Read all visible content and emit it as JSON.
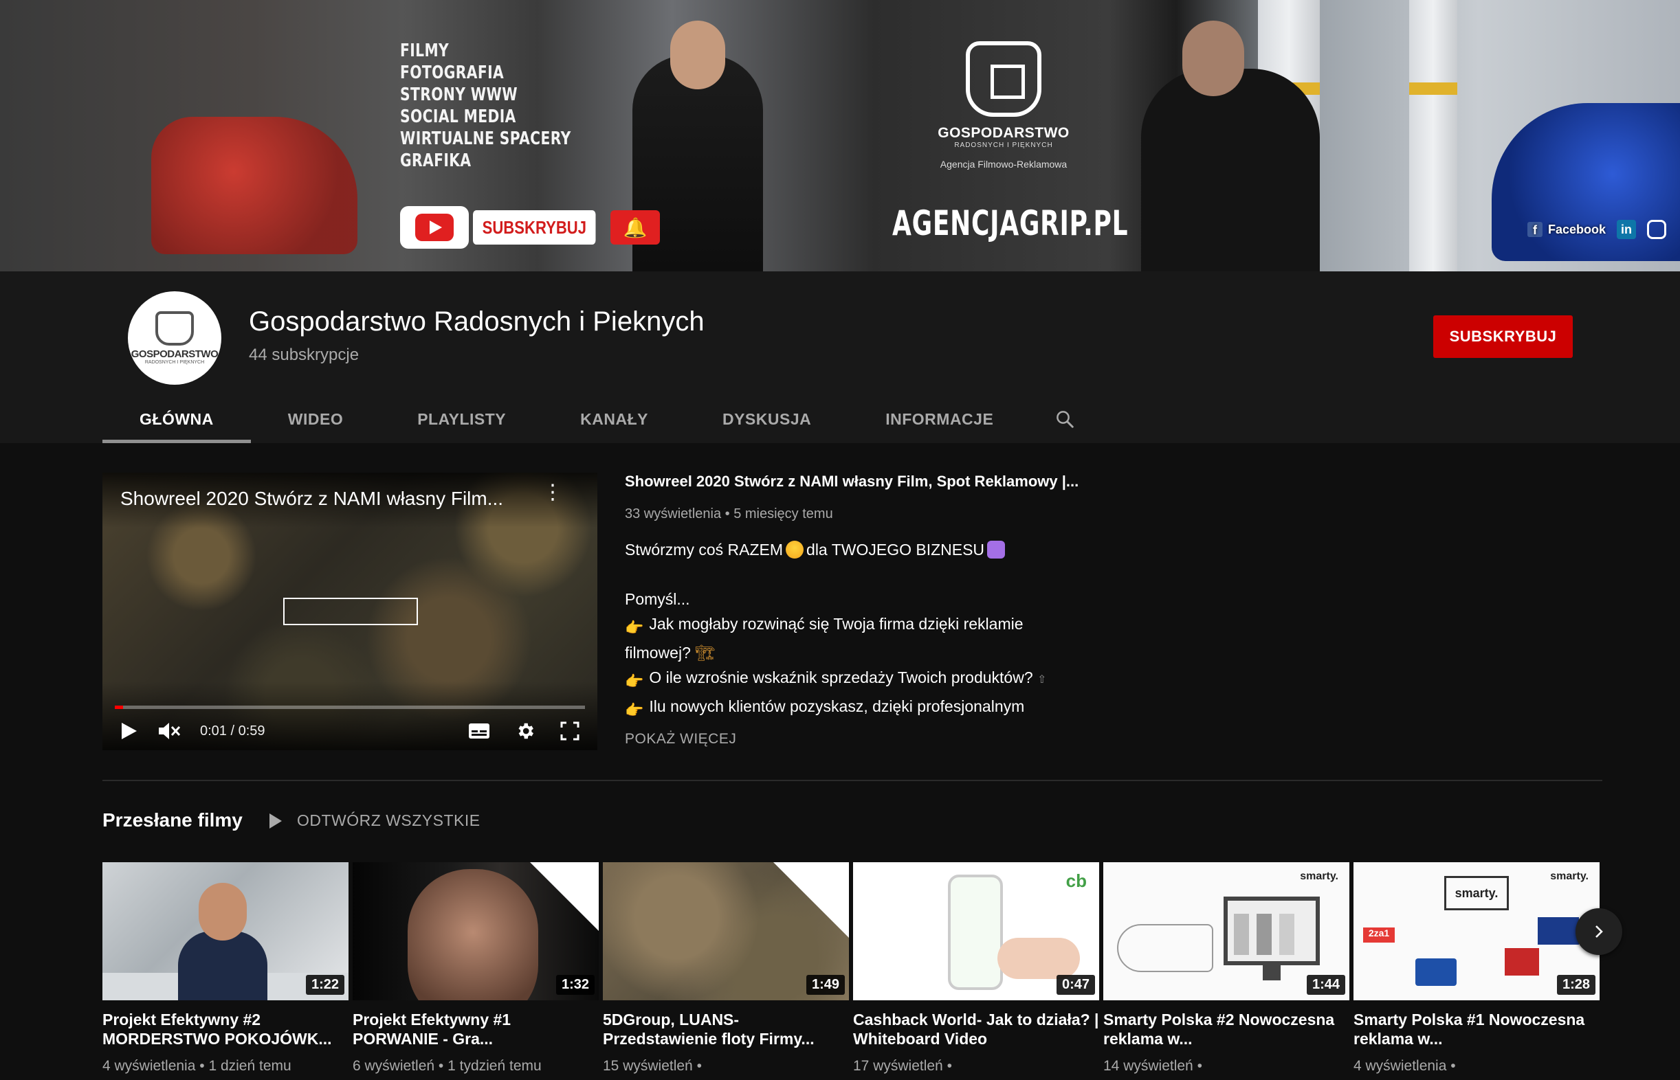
{
  "banner": {
    "services": [
      "FILMY",
      "FOTOGRAFIA",
      "STRONY WWW",
      "SOCIAL MEDIA",
      "WIRTUALNE SPACERY",
      "GRAFIKA"
    ],
    "subscribe_label": "SUBSKRYBUJ",
    "agency_name": "GOSPODARSTWO",
    "agency_sub": "RADOSNYCH I PIĘKNYCH",
    "agency_tagline": "Agencja Filmowo-Reklamowa",
    "agency_url": "AGENCJAGRIP.PL",
    "social_facebook": "Facebook",
    "social_linkedin": "in"
  },
  "channel": {
    "avatar_text": "GOSPODARSTWO",
    "avatar_sub": "RADOSNYCH I PIĘKNYCH",
    "title": "Gospodarstwo Radosnych i Pieknych",
    "subscribers": "44 subskrypcje",
    "subscribe_button": "SUBSKRYBUJ"
  },
  "tabs": [
    {
      "label": "GŁÓWNA",
      "active": true
    },
    {
      "label": "WIDEO"
    },
    {
      "label": "PLAYLISTY"
    },
    {
      "label": "KANAŁY"
    },
    {
      "label": "DYSKUSJA"
    },
    {
      "label": "INFORMACJE"
    }
  ],
  "featured": {
    "player_title": "Showreel 2020 Stwórz z NAMI własny Film...",
    "time": "0:01 / 0:59",
    "progress": 0.017,
    "title": "Showreel 2020 Stwórz z NAMI własny Film, Spot Reklamowy |...",
    "views": "33 wyświetlenia",
    "age": "5 miesięcy temu",
    "desc_line1_a": "Stwórzmy coś RAZEM",
    "desc_line1_b": "dla TWOJEGO BIZNESU",
    "desc_line2": "Pomyśl...",
    "desc_line3": "Jak mogłaby rozwinąć się Twoja firma dzięki reklamie",
    "desc_line4": "filmowej?",
    "desc_line5": "O ile wzrośnie wskaźnik sprzedaży Twoich produktów?",
    "desc_line6": "Ilu nowych klientów pozyskasz, dzięki profesjonalnym",
    "show_more": "POKAŻ WIĘCEJ"
  },
  "uploads": {
    "title": "Przesłane filmy",
    "play_all": "ODTWÓRZ WSZYSTKIE",
    "videos": [
      {
        "title": "Projekt Efektywny #2 MORDERSTWO POKOJÓWK...",
        "duration": "1:22",
        "views": "4 wyświetlenia",
        "age": "1 dzień temu"
      },
      {
        "title": "Projekt Efektywny #1 PORWANIE - Gra...",
        "duration": "1:32",
        "views": "6 wyświetleń",
        "age": "1 tydzień temu"
      },
      {
        "title": "5DGroup, LUANS- Przedstawienie floty Firmy...",
        "duration": "1:49",
        "views": "15 wyświetleń",
        "age": ""
      },
      {
        "title": "Cashback World- Jak to działa? | Whiteboard Video",
        "duration": "0:47",
        "views": "17 wyświetleń",
        "age": ""
      },
      {
        "title": "Smarty Polska #2 Nowoczesna reklama w...",
        "duration": "1:44",
        "views": "14 wyświetleń",
        "age": ""
      },
      {
        "title": "Smarty Polska #1 Nowoczesna reklama w...",
        "duration": "1:28",
        "views": "4 wyświetlenia",
        "age": ""
      }
    ]
  },
  "thumb_text": {
    "cb": "cb",
    "smarty": "smarty.",
    "tag": "2za1"
  },
  "colors": {
    "subscribe_red": "#cc0000",
    "background": "#181818",
    "content_bg": "#0f0f0f"
  }
}
